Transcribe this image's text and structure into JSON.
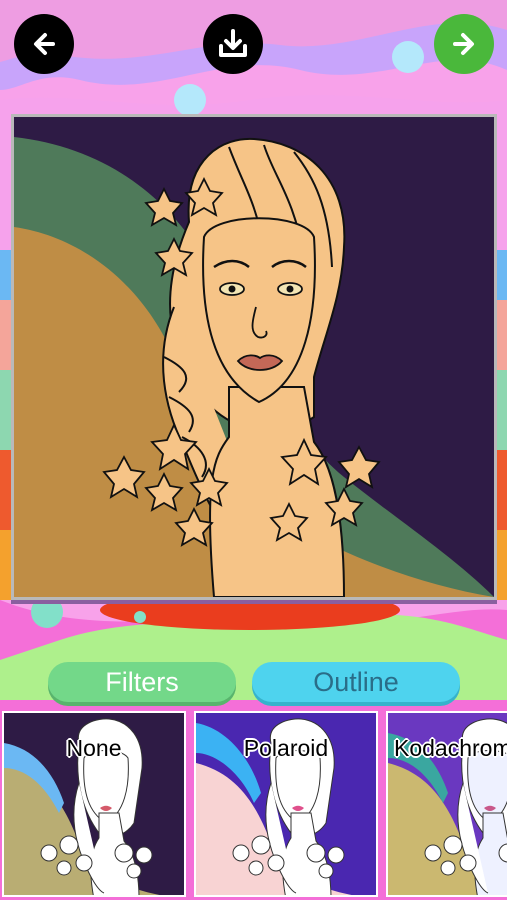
{
  "toolbar": {
    "back_icon": "arrow-left-icon",
    "download_icon": "download-icon",
    "next_icon": "arrow-right-icon",
    "next_color": "#4ab83b"
  },
  "artwork": {
    "subject": "woman-with-flowers-coloring-page",
    "colors": {
      "background": "#2e1b45",
      "skin": "#f6c487",
      "lips": "#c46857",
      "left_band": "#bf8d45",
      "left_band_edge": "#4f7a5a"
    }
  },
  "tabs": {
    "filters_label": "Filters",
    "outline_label": "Outline",
    "active": "Filters"
  },
  "filters": {
    "items": [
      {
        "label": "None"
      },
      {
        "label": "Polaroid"
      },
      {
        "label": "Kodachrome"
      }
    ]
  }
}
